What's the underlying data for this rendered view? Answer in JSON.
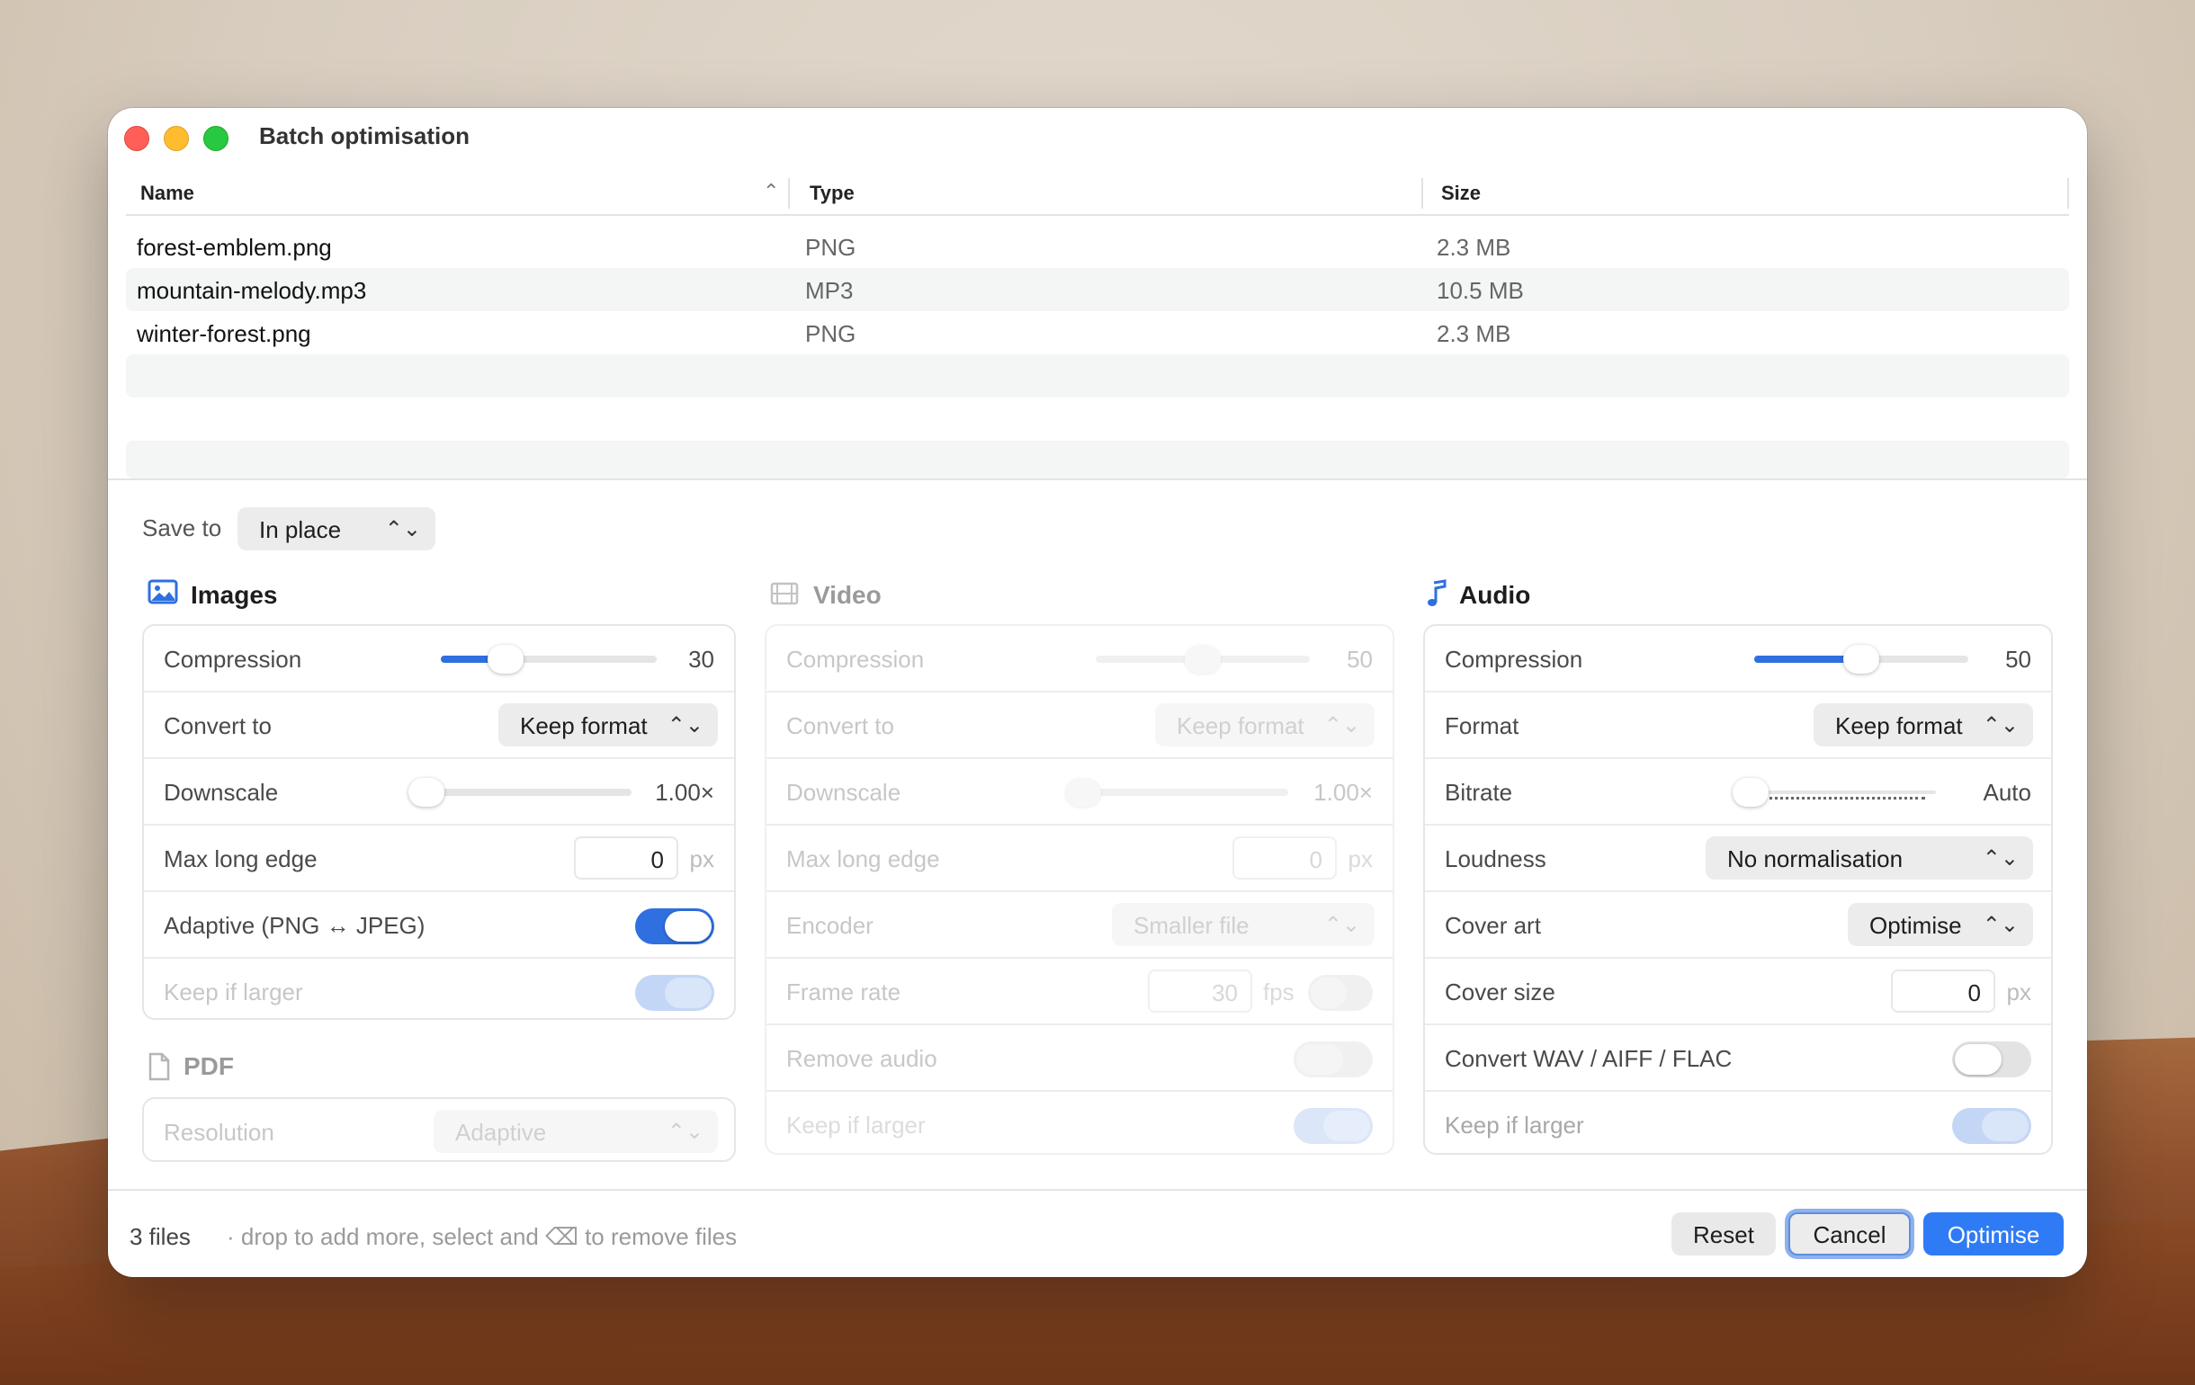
{
  "window": {
    "title": "Batch optimisation"
  },
  "table": {
    "columns": [
      "Name",
      "Type",
      "Size"
    ],
    "rows": [
      {
        "name": "forest-emblem.png",
        "type": "PNG",
        "size": "2.3 MB"
      },
      {
        "name": "mountain-melody.mp3",
        "type": "MP3",
        "size": "10.5 MB"
      },
      {
        "name": "winter-forest.png",
        "type": "PNG",
        "size": "2.3 MB"
      }
    ]
  },
  "save_to": {
    "label": "Save to",
    "value": "In place"
  },
  "images": {
    "title": "Images",
    "compression": {
      "label": "Compression",
      "value": "30",
      "level": 0.3
    },
    "convert_to": {
      "label": "Convert to",
      "value": "Keep format"
    },
    "downscale": {
      "label": "Downscale",
      "value": "1.00×",
      "level": 0.0
    },
    "max_long_edge": {
      "label": "Max long edge",
      "value": "0",
      "unit": "px"
    },
    "adaptive": {
      "label": "Adaptive (PNG ↔ JPEG)",
      "on": true
    },
    "keep_if_larger": {
      "label": "Keep if larger",
      "on": true,
      "disabled": true
    }
  },
  "pdf": {
    "title": "PDF",
    "resolution": {
      "label": "Resolution",
      "value": "Adaptive"
    }
  },
  "video": {
    "title": "Video",
    "compression": {
      "label": "Compression",
      "value": "50",
      "level": 0.5
    },
    "convert_to": {
      "label": "Convert to",
      "value": "Keep format"
    },
    "downscale": {
      "label": "Downscale",
      "value": "1.00×",
      "level": 0.0
    },
    "max_long_edge": {
      "label": "Max long edge",
      "value": "0",
      "unit": "px"
    },
    "encoder": {
      "label": "Encoder",
      "value": "Smaller file"
    },
    "frame_rate": {
      "label": "Frame rate",
      "value": "30",
      "unit": "fps"
    },
    "remove_audio": {
      "label": "Remove audio"
    },
    "keep_if_larger": {
      "label": "Keep if larger"
    }
  },
  "audio": {
    "title": "Audio",
    "compression": {
      "label": "Compression",
      "value": "50",
      "level": 0.5
    },
    "format": {
      "label": "Format",
      "value": "Keep format"
    },
    "bitrate": {
      "label": "Bitrate",
      "value": "Auto"
    },
    "loudness": {
      "label": "Loudness",
      "value": "No normalisation"
    },
    "cover_art": {
      "label": "Cover art",
      "value": "Optimise"
    },
    "cover_size": {
      "label": "Cover size",
      "value": "0",
      "unit": "px"
    },
    "convert_wav": {
      "label": "Convert WAV / AIFF / FLAC",
      "on": false
    },
    "keep_if_larger": {
      "label": "Keep if larger",
      "on": true,
      "disabled": true
    }
  },
  "footer": {
    "count": "3 files",
    "hint": "·  drop to add more, select and ⌫ to remove files",
    "reset": "Reset",
    "cancel": "Cancel",
    "optimise": "Optimise"
  },
  "colors": {
    "accent": "#2f7bf6",
    "toggle_on": "#2f6fe0"
  }
}
